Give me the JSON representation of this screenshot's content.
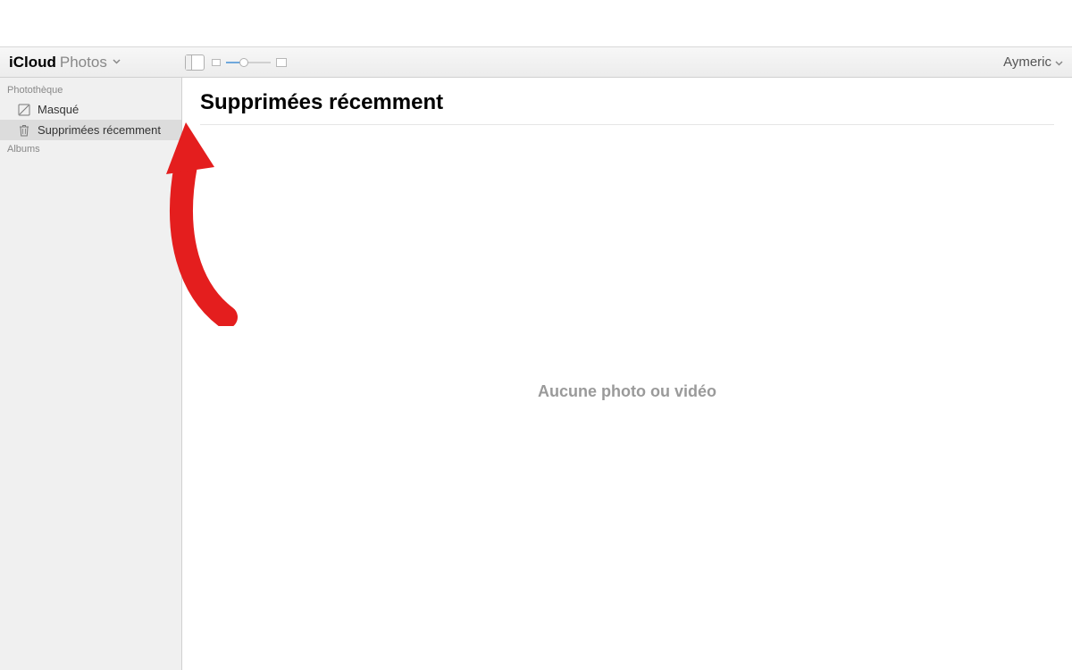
{
  "header": {
    "brand": "iCloud",
    "section": "Photos",
    "user_name": "Aymeric"
  },
  "sidebar": {
    "sections": [
      {
        "header": "Photothèque",
        "items": [
          {
            "icon": "hidden-icon",
            "label": "Masqué",
            "selected": false
          },
          {
            "icon": "trash-icon",
            "label": "Supprimées récemment",
            "selected": true
          }
        ]
      },
      {
        "header": "Albums",
        "items": []
      }
    ]
  },
  "content": {
    "title": "Supprimées récemment",
    "empty_message": "Aucune photo ou vidéo"
  }
}
